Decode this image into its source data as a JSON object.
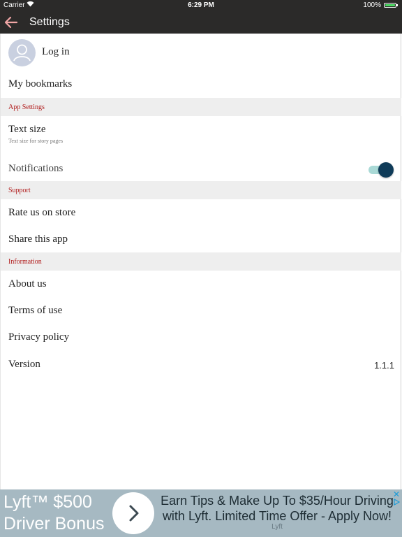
{
  "status_bar": {
    "carrier": "Carrier",
    "time": "6:29 PM",
    "battery": "100%",
    "battery_color": "#4cd964"
  },
  "nav": {
    "title": "Settings",
    "back_icon": "arrow-left-icon"
  },
  "account": {
    "login_label": "Log in",
    "avatar_icon": "user-avatar-icon"
  },
  "items": {
    "bookmarks": "My bookmarks",
    "text_size": "Text size",
    "text_size_sub": "Text size for story pages",
    "notifications": "Notifications",
    "notifications_on": true,
    "rate": "Rate us on store",
    "share": "Share this app",
    "about": "About us",
    "terms": "Terms of use",
    "privacy": "Privacy policy",
    "version_label": "Version",
    "version_value": "1.1.1"
  },
  "sections": {
    "app_settings": "App Settings",
    "support": "Support",
    "information": "Information"
  },
  "colors": {
    "header_bg": "#2b2a29",
    "section_text": "#b01a1a",
    "toggle_knob": "#0f3b58",
    "toggle_track": "#a9d9d6",
    "ad_bg": "#a6b9c2"
  },
  "ad": {
    "brand": "Lyft™ $500 Driver Bonus",
    "headline": "Earn Tips & Make Up To $35/Hour Driving with Lyft. Limited Time Offer - Apply Now!",
    "advertiser": "Lyft",
    "close": "✕"
  }
}
